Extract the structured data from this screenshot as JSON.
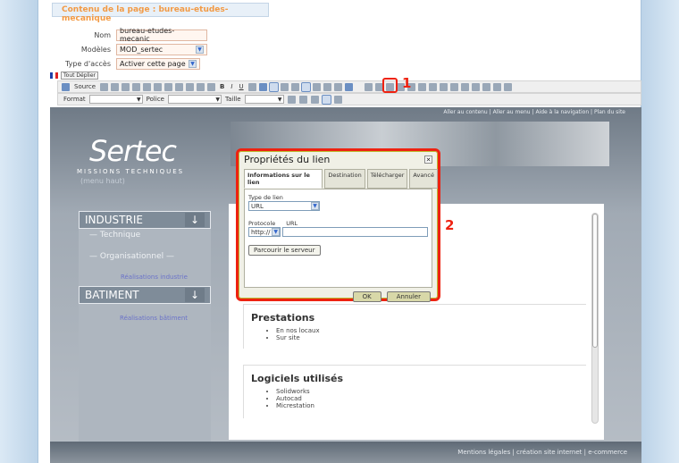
{
  "page_tab": "Contenu de la page : bureau-etudes-mecanique",
  "form": {
    "nom_label": "Nom",
    "nom_value": "bureau-etudes-mecanic",
    "modeles_label": "Modèles",
    "modeles_value": "MOD_sertec",
    "acces_label": "Type d'accès",
    "acces_value": "Activer cette page"
  },
  "editor": {
    "tout_deplier": "Tout Déplier",
    "source_label": "Source",
    "format_label": "Format",
    "police_label": "Police",
    "taille_label": "Taille"
  },
  "annotations": {
    "one": "1",
    "two": "2"
  },
  "site": {
    "topnav": "Aller au contenu  |  Aller au menu  |  Aide à la navigation  |  Plan du site",
    "logo": "Sertec",
    "tagline": "MISSIONS TECHNIQUES",
    "menu_haut": "(menu haut)",
    "sidebar": {
      "industrie": "INDUSTRIE",
      "technique": "Technique",
      "organisationnel": "Organisationnel",
      "realisations_industrie": "Réalisations industrie",
      "batiment": "BATIMENT",
      "realisations_batiment": "Réalisations bâtiment"
    },
    "prestations_title": "Prestations",
    "prestations_items": [
      "En nos locaux",
      "Sur site"
    ],
    "logiciels_title": "Logiciels utilisés",
    "logiciels_items": [
      "Solidworks",
      "Autocad",
      "Micrestation"
    ],
    "footer": "Mentions légales  |  création site internet  |  e-commerce"
  },
  "dialog": {
    "title": "Propriétés du lien",
    "tabs": [
      "Informations sur le lien",
      "Destination",
      "Télécharger",
      "Avancé"
    ],
    "type_label": "Type de lien",
    "type_value": "URL",
    "protocole_label": "Protocole",
    "url_label": "URL",
    "protocole_value": "http://",
    "browse_button": "Parcourir le serveur",
    "ok": "OK",
    "cancel": "Annuler"
  }
}
